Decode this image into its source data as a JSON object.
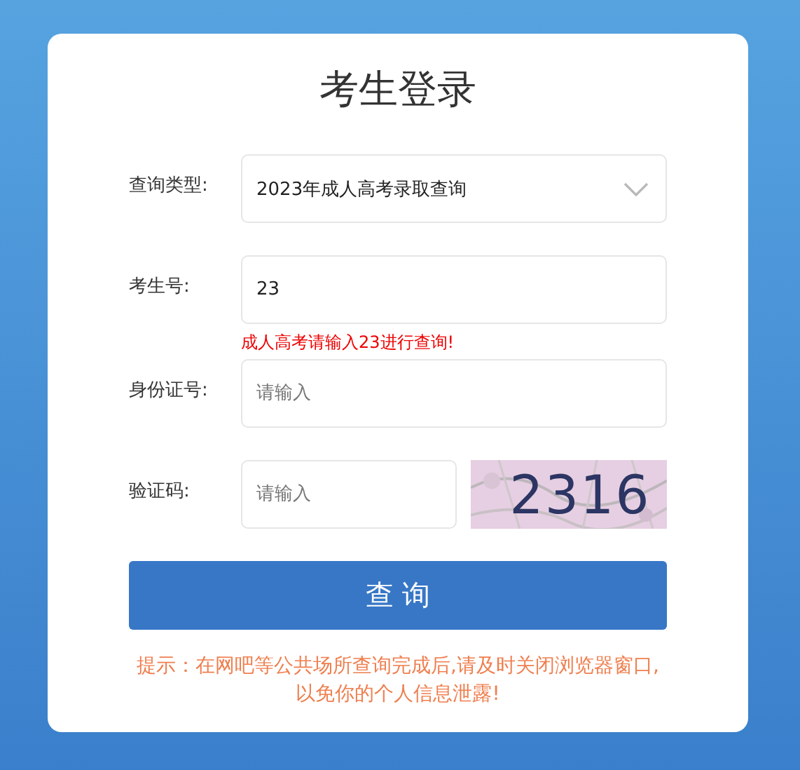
{
  "title": "考生登录",
  "fields": [
    {
      "kind": "select",
      "label": "查询类型:",
      "value": "2023年成人高考录取查询"
    },
    {
      "kind": "input",
      "label": "考生号:",
      "value": "23",
      "error": "成人高考请输入23进行查询!"
    },
    {
      "kind": "input",
      "label": "身份证号:",
      "placeholder": "请输入"
    },
    {
      "kind": "captcha",
      "label": "验证码:",
      "placeholder": "请输入",
      "captcha": "2316"
    }
  ],
  "submit": "查 询",
  "tip": "提示：在网吧等公共场所查询完成后,请及时关闭浏览器窗口,以免你的个人信息泄露!"
}
